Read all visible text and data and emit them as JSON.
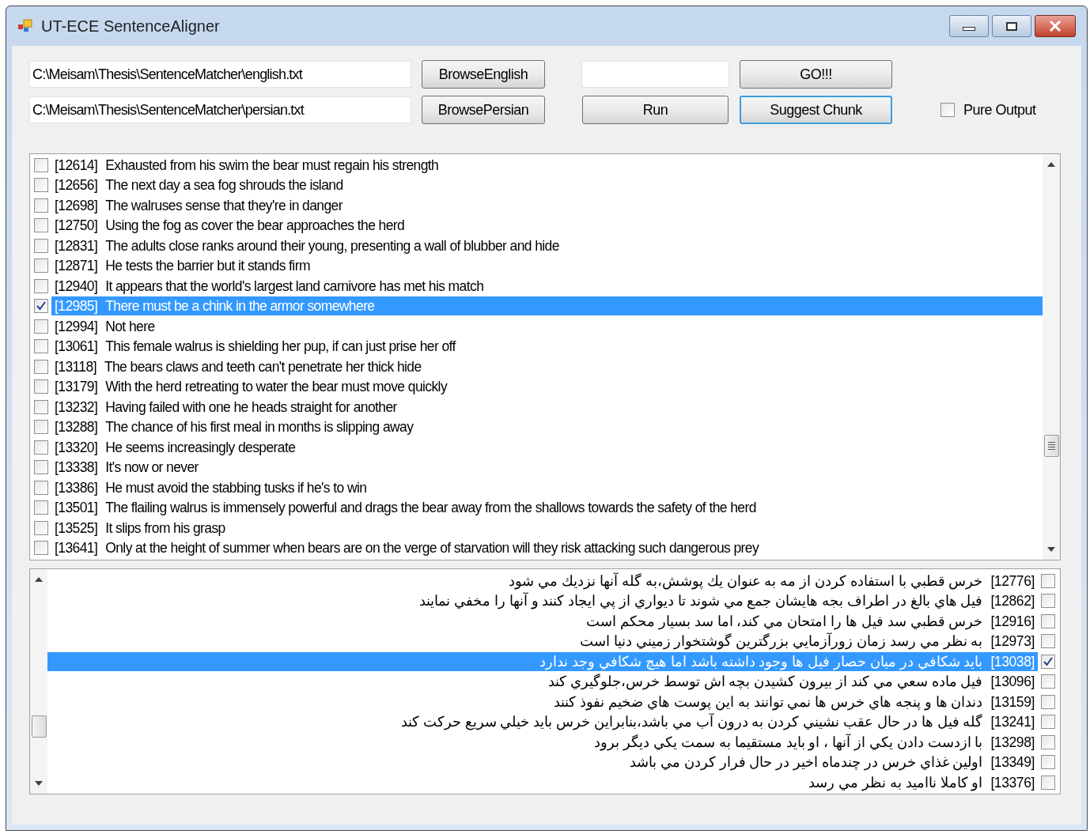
{
  "window": {
    "title": "UT-ECE SentenceAligner"
  },
  "english_path": {
    "value": "C:\\Meisam\\Thesis\\SentenceMatcher\\english.txt"
  },
  "persian_path": {
    "value": "C:\\Meisam\\Thesis\\SentenceMatcher\\persian.txt"
  },
  "buttons": [
    {
      "label": "BrowseEnglish",
      "focused": false
    },
    {
      "label": "GO!!!",
      "focused": false
    },
    {
      "label": "BrowsePersian",
      "focused": false
    },
    {
      "label": "Run",
      "focused": false
    },
    {
      "label": "Suggest Chunk",
      "focused": true
    }
  ],
  "pure_output": {
    "label": "Pure Output",
    "checked": false
  },
  "english_list": [
    {
      "id": "[12614]",
      "text": "Exhausted from his swim the bear must regain his strength",
      "checked": false,
      "selected": false
    },
    {
      "id": "[12656]",
      "text": "The next day a sea fog shrouds the island",
      "checked": false,
      "selected": false
    },
    {
      "id": "[12698]",
      "text": "The walruses sense that they're in danger",
      "checked": false,
      "selected": false
    },
    {
      "id": "[12750]",
      "text": "Using the fog as cover the bear approaches the herd",
      "checked": false,
      "selected": false
    },
    {
      "id": "[12831]",
      "text": "The adults close ranks around their young, presenting a wall of blubber and hide",
      "checked": false,
      "selected": false
    },
    {
      "id": "[12871]",
      "text": "He tests the barrier but it stands firm",
      "checked": false,
      "selected": false
    },
    {
      "id": "[12940]",
      "text": "It appears that the world's largest land carnivore has met his match",
      "checked": false,
      "selected": false
    },
    {
      "id": "[12985]",
      "text": "There must be a chink in the armor somewhere",
      "checked": true,
      "selected": true
    },
    {
      "id": "[12994]",
      "text": "Not here",
      "checked": false,
      "selected": false
    },
    {
      "id": "[13061]",
      "text": "This female walrus is shielding her pup, if can just prise her off",
      "checked": false,
      "selected": false
    },
    {
      "id": "[13118]",
      "text": "The bears claws and teeth can't penetrate her thick hide",
      "checked": false,
      "selected": false
    },
    {
      "id": "[13179]",
      "text": "With the herd retreating to water the bear must move quickly",
      "checked": false,
      "selected": false
    },
    {
      "id": "[13232]",
      "text": "Having failed with one he heads straight for another",
      "checked": false,
      "selected": false
    },
    {
      "id": "[13288]",
      "text": "The chance of his first meal in months is slipping away",
      "checked": false,
      "selected": false
    },
    {
      "id": "[13320]",
      "text": "He seems increasingly desperate",
      "checked": false,
      "selected": false
    },
    {
      "id": "[13338]",
      "text": "It's now or never",
      "checked": false,
      "selected": false
    },
    {
      "id": "[13386]",
      "text": "He must avoid the stabbing tusks if he's to win",
      "checked": false,
      "selected": false
    },
    {
      "id": "[13501]",
      "text": "The flailing walrus is immensely powerful and drags the bear away from the shallows towards the safety of the herd",
      "checked": false,
      "selected": false
    },
    {
      "id": "[13525]",
      "text": "It slips from his grasp",
      "checked": false,
      "selected": false
    },
    {
      "id": "[13641]",
      "text": "Only at the height of summer when bears are on the verge of starvation will they risk attacking such dangerous prey",
      "checked": false,
      "selected": false
    }
  ],
  "persian_list": [
    {
      "id": "[12776]",
      "text": "خرس قطبي با استفاده كردن از مه به عنوان يك پوشش،به گله آنها نزديك مي شود",
      "checked": false,
      "selected": false
    },
    {
      "id": "[12862]",
      "text": "فيل هاي بالغ در اطراف بجه هايشان جمع مي شوند تا ديواري از پي ايجاد كنند و آنها را مخفي نمايند",
      "checked": false,
      "selected": false
    },
    {
      "id": "[12916]",
      "text": "خرس قطبي سد فيل ها را امتحان مي كند، اما سد بسيار محكم است",
      "checked": false,
      "selected": false
    },
    {
      "id": "[12973]",
      "text": "به نظر مي رسد زمان زورآزمايي بزرگترين گوشتخوار زميني دنيا است",
      "checked": false,
      "selected": false
    },
    {
      "id": "[13038]",
      "text": "بايد شكافي در ميان حصار فيل ها وجود داشته باشد اما هيچ شكافي وجد ندارد",
      "checked": true,
      "selected": true
    },
    {
      "id": "[13096]",
      "text": "فيل ماده سعي مي كند از بيرون كشيدن بچه اش توسط خرس،جلوگيري كند",
      "checked": false,
      "selected": false
    },
    {
      "id": "[13159]",
      "text": "دندان ها و پنجه هاي خرس ها نمي توانند به اين پوست هاي ضخيم نفوذ كنند",
      "checked": false,
      "selected": false
    },
    {
      "id": "[13241]",
      "text": "گله فيل ها در حال عقب نشيني كردن به درون آب مي باشد،بنابراين خرس بايد خيلي سريع حركت كند",
      "checked": false,
      "selected": false
    },
    {
      "id": "[13298]",
      "text": "با ازدست دادن يكي از آنها ، او بايد مستقيما به سمت يكي ديگر برود",
      "checked": false,
      "selected": false
    },
    {
      "id": "[13349]",
      "text": "اولين غذاي خرس در چندماه اخير در حال فرار كردن مي باشد",
      "checked": false,
      "selected": false
    },
    {
      "id": "[13376]",
      "text": "او كاملا نااميد به نظر مي رسد",
      "checked": false,
      "selected": false
    }
  ]
}
